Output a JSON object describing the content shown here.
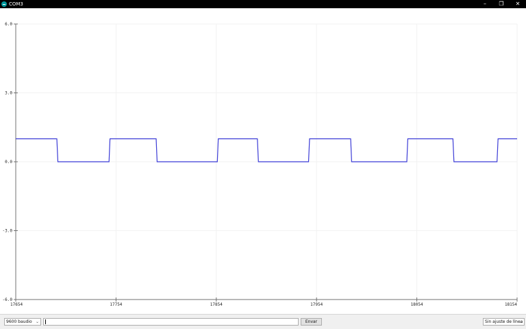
{
  "window": {
    "title": "COM3",
    "icons": {
      "app": "arduino-icon",
      "minimize": "minimize-icon",
      "maximize": "restore-icon",
      "close": "close-icon"
    }
  },
  "plotter": {
    "colors": {
      "line": "#3b3bd6",
      "axis": "#707070",
      "grid": "#f2f2f2"
    }
  },
  "chart_data": {
    "type": "line",
    "title": "",
    "xlabel": "",
    "ylabel": "",
    "x_tick_labels": [
      "17654",
      "17754",
      "17854",
      "17954",
      "18054",
      "18154"
    ],
    "y_tick_labels": [
      "6.0",
      "3.0",
      "0.0",
      "-3.0",
      "-6.0"
    ],
    "y_ticks": [
      6,
      3,
      0,
      -3,
      -6
    ],
    "ylim": [
      -6,
      6
    ],
    "xlim": [
      17654,
      18154
    ],
    "grid": true,
    "series": [
      {
        "x": [
          17654,
          17695,
          17696,
          17747,
          17748,
          17794,
          17795,
          17855,
          17856,
          17895,
          17896,
          17946,
          17947,
          17988,
          17989,
          18044,
          18045,
          18090,
          18091,
          18134,
          18135,
          18154
        ],
        "values": [
          1,
          1,
          0,
          0,
          1,
          1,
          0,
          0,
          1,
          1,
          0,
          0,
          1,
          1,
          0,
          0,
          1,
          1,
          0,
          0,
          1,
          1
        ]
      }
    ]
  },
  "bottom": {
    "baud_select": "9600 baudio",
    "input_value": "",
    "send_button": "Envar",
    "line_ending_select": "Sin ajuste de línea",
    "chevron_icon": "chevron-down-icon"
  }
}
